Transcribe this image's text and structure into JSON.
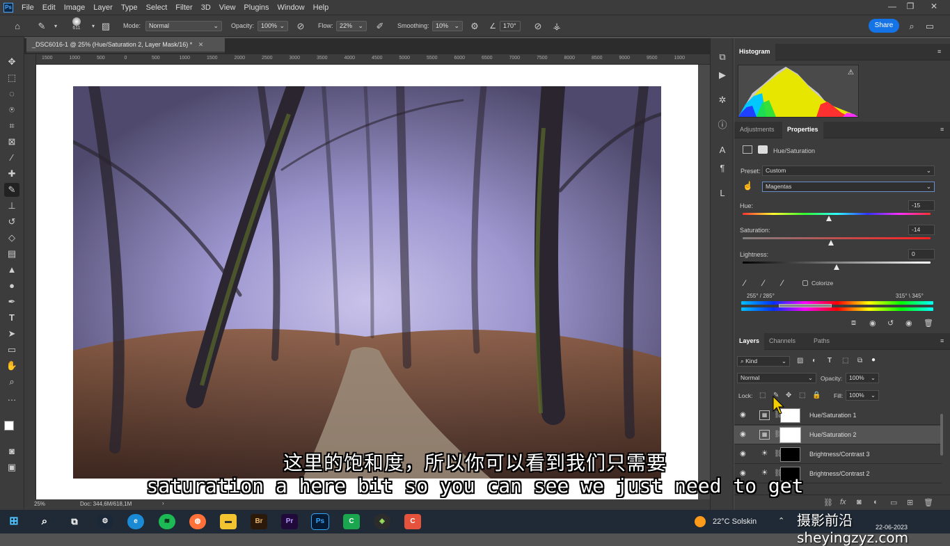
{
  "app": {
    "logo": "Ps"
  },
  "menu": [
    "File",
    "Edit",
    "Image",
    "Layer",
    "Type",
    "Select",
    "Filter",
    "3D",
    "View",
    "Plugins",
    "Window",
    "Help"
  ],
  "options": {
    "brush_size": "611",
    "mode_label": "Mode:",
    "mode_value": "Normal",
    "opacity_label": "Opacity:",
    "opacity_value": "100%",
    "flow_label": "Flow:",
    "flow_value": "22%",
    "smoothing_label": "Smoothing:",
    "smoothing_value": "10%",
    "angle_value": "170°",
    "share_label": "Share"
  },
  "document": {
    "tab_title": "_DSC6016-1 @ 25% (Hue/Saturation 2, Layer Mask/16) *",
    "ruler_ticks": [
      "1500",
      "1000",
      "500",
      "0",
      "500",
      "1000",
      "1500",
      "2000",
      "2500",
      "3000",
      "3500",
      "4000",
      "4500",
      "5000",
      "5500",
      "6000",
      "6500",
      "7000",
      "7500",
      "8000",
      "8500",
      "9000",
      "9500",
      "1000"
    ],
    "zoom": "25%",
    "doc_info": "Doc: 344,6M/618,1M"
  },
  "histogram": {
    "title": "Histogram"
  },
  "properties": {
    "tabs": [
      "Adjustments",
      "Properties"
    ],
    "type_label": "Hue/Saturation",
    "preset_label": "Preset:",
    "preset_value": "Custom",
    "channel_value": "Magentas",
    "hue_label": "Hue:",
    "hue_value": "-15",
    "hue_fraction": 0.46,
    "saturation_label": "Saturation:",
    "saturation_value": "-14",
    "saturation_fraction": 0.47,
    "lightness_label": "Lightness:",
    "lightness_value": "0",
    "lightness_fraction": 0.5,
    "colorize_label": "Colorize",
    "range_left": "255° / 285°",
    "range_right": "315° \\ 345°"
  },
  "layers": {
    "tabs": [
      "Layers",
      "Channels",
      "Paths"
    ],
    "kind_label": "Kind",
    "blend_value": "Normal",
    "opacity_label": "Opacity:",
    "opacity_value": "100%",
    "lock_label": "Lock:",
    "fill_label": "Fill:",
    "fill_value": "100%",
    "items": [
      {
        "name": "Hue/Saturation 1",
        "selected": false,
        "mask": "white"
      },
      {
        "name": "Hue/Saturation 2",
        "selected": true,
        "mask": "white"
      },
      {
        "name": "Brightness/Contrast 3",
        "selected": false,
        "mask": "black"
      },
      {
        "name": "Brightness/Contrast 2",
        "selected": false,
        "mask": "black"
      }
    ]
  },
  "taskbar": {
    "weather": "22°C  Solskin",
    "date": "22-06-2023",
    "apps": [
      "Br",
      "Pr",
      "Ps"
    ]
  },
  "subtitles": {
    "chinese": "这里的饱和度，所以你可以看到我们只需要",
    "english": "saturation a here bit so you can see we just need to get"
  },
  "watermark": "摄影前沿sheyingzyz.com"
}
